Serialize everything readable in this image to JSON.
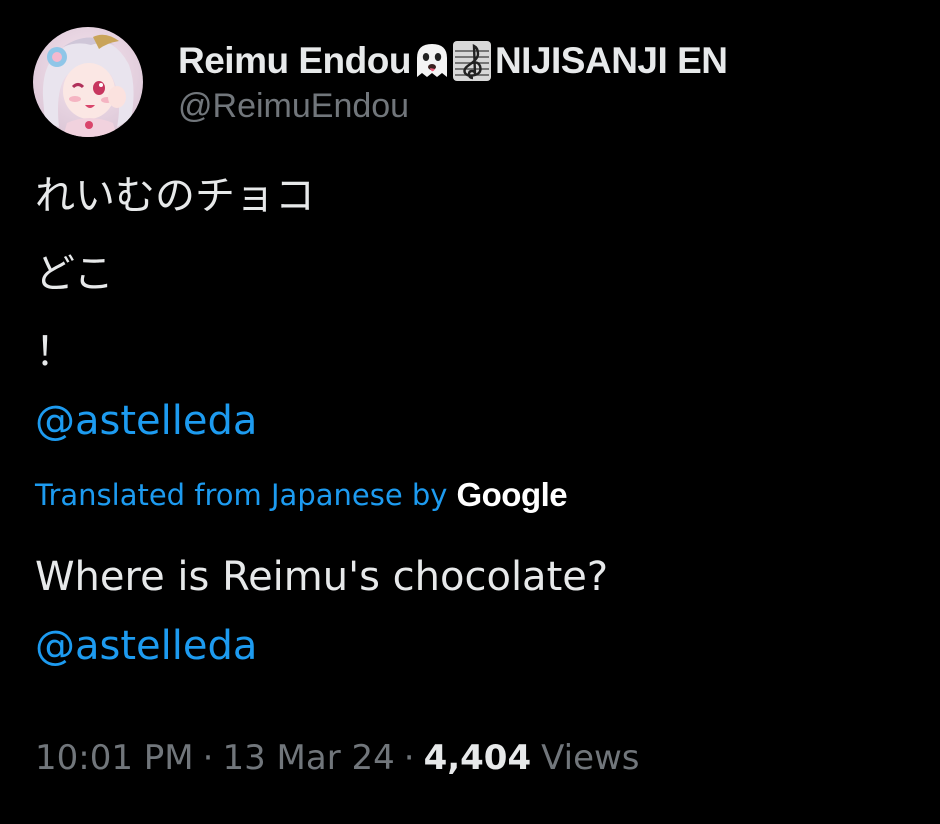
{
  "tweet": {
    "author": {
      "display_name": "Reimu Endou",
      "emoji_1": "ghost-emoji",
      "emoji_2": "treble-clef-emoji",
      "affiliation": "NIJISANJI EN",
      "handle": "@ReimuEndou",
      "avatar": "avatar-image"
    },
    "text_lines": [
      "れいむのチョコ",
      "どこ",
      "！"
    ],
    "mention": "@astelleda",
    "translation": {
      "label": "Translated from Japanese by",
      "provider": "Google",
      "text": "Where is Reimu's chocolate?",
      "mention": "@astelleda"
    },
    "meta": {
      "time": "10:01 PM",
      "separator": "·",
      "date": "13 Mar 24",
      "views_count": "4,404",
      "views_label": "Views"
    }
  },
  "colors": {
    "background": "#000000",
    "text": "#e7e9ea",
    "secondary": "#71767b",
    "link": "#1d9bf0"
  }
}
